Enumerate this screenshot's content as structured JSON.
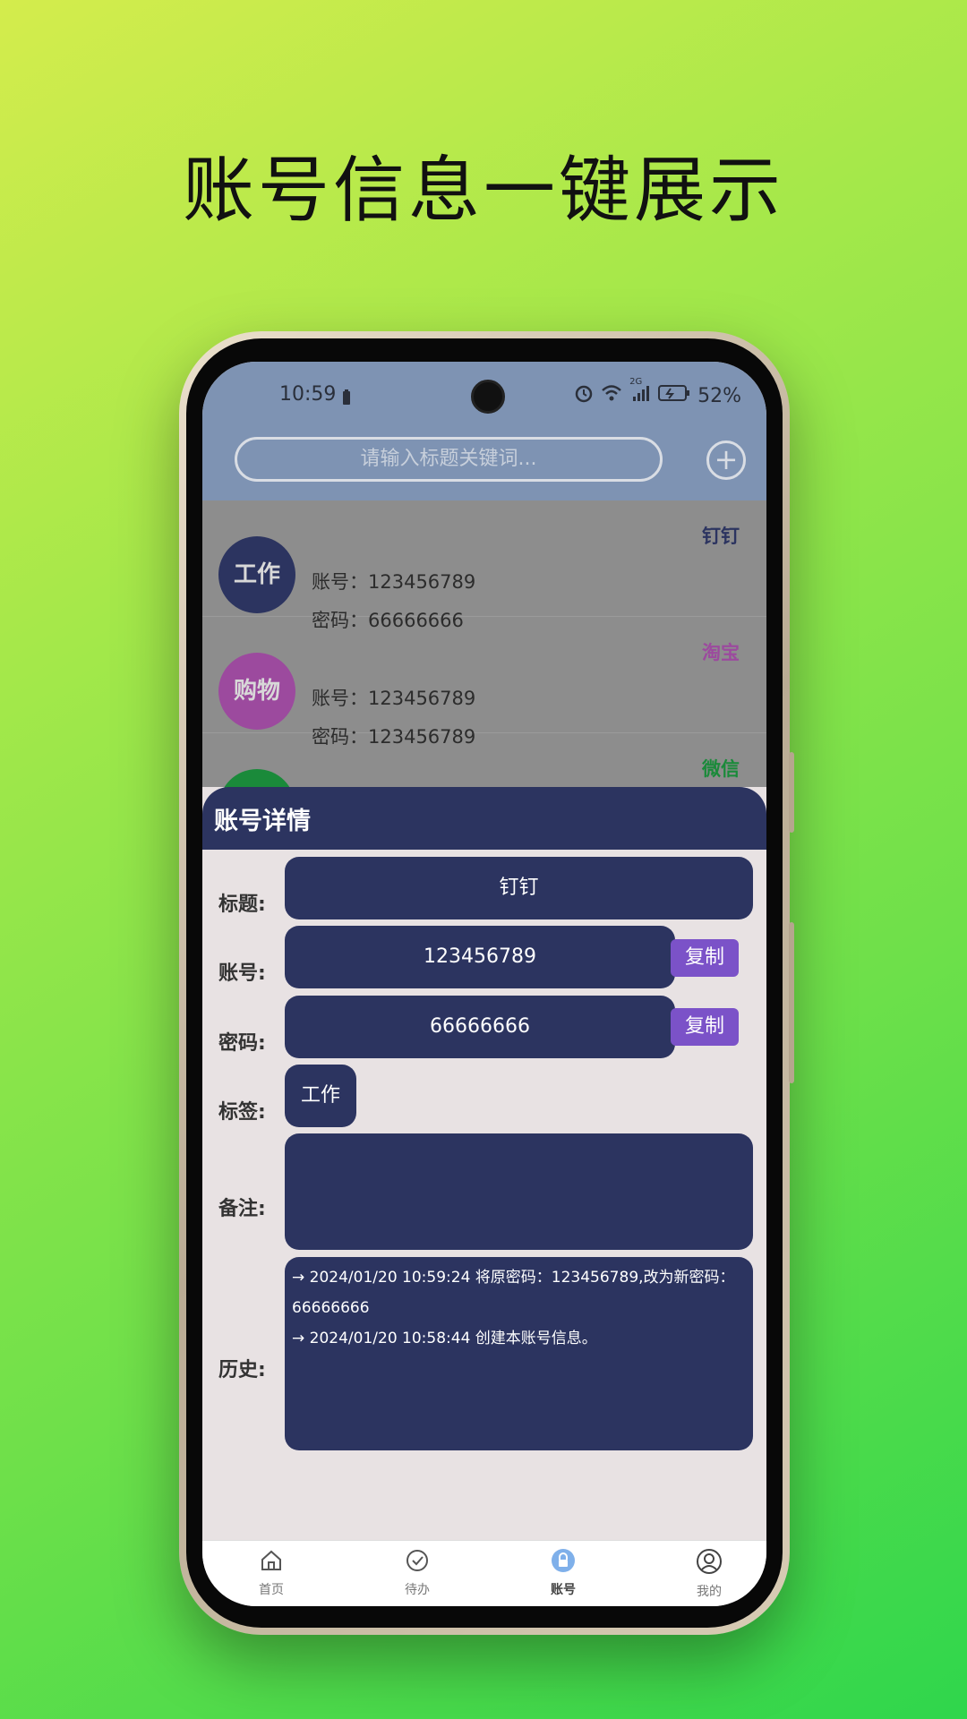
{
  "headline": "账号信息一键展示",
  "status": {
    "time": "10:59",
    "signal_text": "2G",
    "battery": "52%"
  },
  "search": {
    "placeholder": "请输入标题关键词..."
  },
  "list": [
    {
      "avatar": "工作",
      "avatar_color": "#2c3460",
      "name": "钉钉",
      "name_color": "#2c3460",
      "account_label": "账号：",
      "account": "123456789",
      "password_label": "密码：",
      "password": "66666666"
    },
    {
      "avatar": "购物",
      "avatar_color": "#9c4a9e",
      "name": "淘宝",
      "name_color": "#9c4a9e",
      "account_label": "账号：",
      "account": "123456789",
      "password_label": "密码：",
      "password": "123456789"
    },
    {
      "avatar": "",
      "avatar_color": "#1a8a3a",
      "name": "微信",
      "name_color": "#1a8a3a"
    }
  ],
  "detail": {
    "header": "账号详情",
    "title_label": "标题:",
    "title_value": "钉钉",
    "account_label": "账号:",
    "account_value": "123456789",
    "password_label": "密码:",
    "password_value": "66666666",
    "copy_label": "复制",
    "tag_label": "标签:",
    "tag_value": "工作",
    "note_label": "备注:",
    "note_value": "",
    "history_label": "历史:",
    "history": [
      "→ 2024/01/20 10:59:24 将原密码：123456789,改为新密码：",
      "66666666",
      "→ 2024/01/20 10:58:44 创建本账号信息。"
    ]
  },
  "tabs": [
    {
      "label": "首页",
      "icon": "home-icon"
    },
    {
      "label": "待办",
      "icon": "check-badge-icon"
    },
    {
      "label": "账号",
      "icon": "lock-icon"
    },
    {
      "label": "我的",
      "icon": "user-icon"
    }
  ],
  "colors": {
    "primary": "#2c3460",
    "copy": "#7b52c8",
    "tab_active": "#7fb0ea"
  }
}
